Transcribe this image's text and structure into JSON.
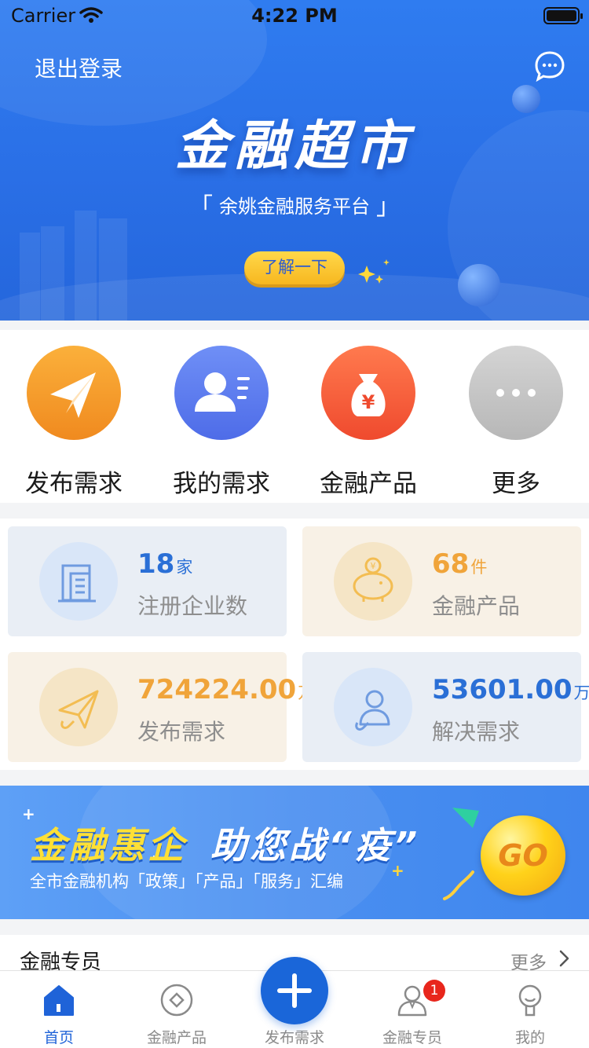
{
  "status_bar": {
    "carrier": "Carrier",
    "time": "4:22 PM"
  },
  "header": {
    "logout_label": "退出登录",
    "title": "金融超市",
    "subtitle": "余姚金融服务平台",
    "subtitle_left_bracket": "「",
    "subtitle_right_bracket": "」",
    "learn_more_label": "了解一下"
  },
  "quick_actions": [
    {
      "label": "发布需求",
      "icon": "paper-plane-icon",
      "color": "#f59a2a"
    },
    {
      "label": "我的需求",
      "icon": "id-card-icon",
      "color": "#5b7cf0"
    },
    {
      "label": "金融产品",
      "icon": "money-bag-icon",
      "color": "#f25b3b"
    },
    {
      "label": "更多",
      "icon": "more-dots-icon",
      "color": "#c2c2c2"
    }
  ],
  "stats": [
    {
      "value": "18",
      "unit": "家",
      "label": "注册企业数",
      "icon": "building-icon"
    },
    {
      "value": "68",
      "unit": "件",
      "label": "金融产品",
      "icon": "piggy-bank-icon"
    },
    {
      "value": "724224.00",
      "unit": "万",
      "label": "发布需求",
      "icon": "paper-plane-icon"
    },
    {
      "value": "53601.00",
      "unit": "万",
      "label": "解决需求",
      "icon": "user-help-icon"
    }
  ],
  "banner": {
    "title_left": "金融惠企",
    "title_right": "助您战“疫”",
    "subtitle": "全市金融机构「政策」「产品」「服务」汇编",
    "go_label": "GO"
  },
  "specialist": {
    "title": "金融专员",
    "more_label": "更多"
  },
  "tab_bar": {
    "items": [
      {
        "label": "首页",
        "icon": "home-icon",
        "active": true
      },
      {
        "label": "金融产品",
        "icon": "coin-icon",
        "active": false
      },
      {
        "label": "发布需求",
        "icon": "plus-icon",
        "active": false
      },
      {
        "label": "金融专员",
        "icon": "person-icon",
        "active": false
      },
      {
        "label": "我的",
        "icon": "profile-icon",
        "active": false
      }
    ],
    "badge_count": "1"
  },
  "colors": {
    "primary": "#1f63d8",
    "accent_orange": "#f0a43a",
    "badge_red": "#e8261c"
  }
}
